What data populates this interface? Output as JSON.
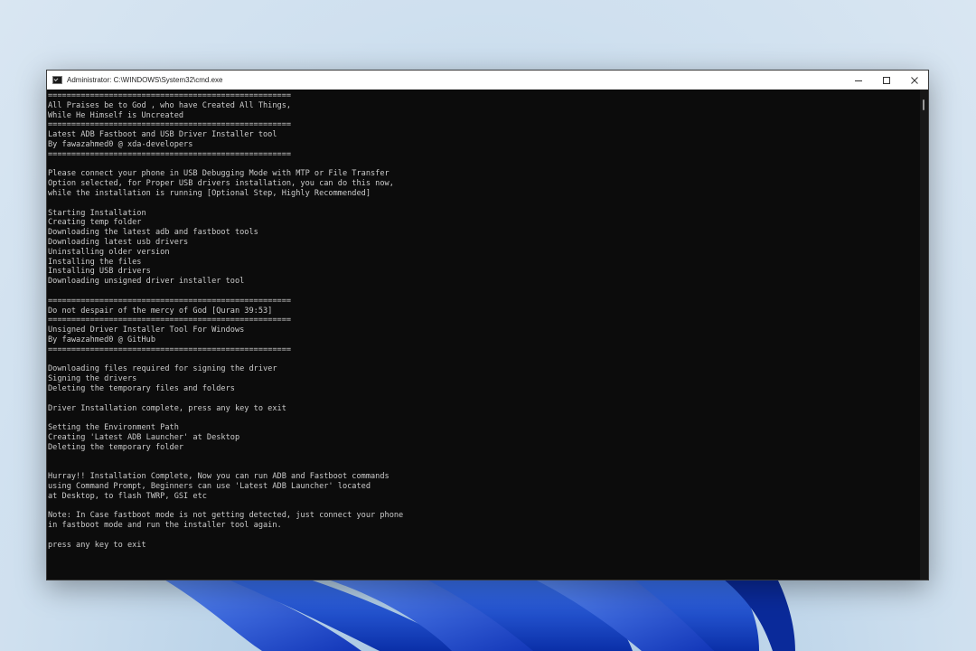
{
  "window": {
    "title": "Administrator: C:\\WINDOWS\\System32\\cmd.exe",
    "icon": "cmd-icon",
    "controls": {
      "minimize": "minimize-icon",
      "maximize": "maximize-icon",
      "close": "close-icon"
    }
  },
  "console": {
    "lines": [
      "====================================================",
      "All Praises be to God , who have Created All Things,",
      "While He Himself is Uncreated",
      "====================================================",
      "Latest ADB Fastboot and USB Driver Installer tool",
      "By fawazahmed0 @ xda-developers",
      "====================================================",
      "",
      "Please connect your phone in USB Debugging Mode with MTP or File Transfer",
      "Option selected, for Proper USB drivers installation, you can do this now,",
      "while the installation is running [Optional Step, Highly Recommended]",
      "",
      "Starting Installation",
      "Creating temp folder",
      "Downloading the latest adb and fastboot tools",
      "Downloading latest usb drivers",
      "Uninstalling older version",
      "Installing the files",
      "Installing USB drivers",
      "Downloading unsigned driver installer tool",
      "",
      "====================================================",
      "Do not despair of the mercy of God [Quran 39:53]",
      "====================================================",
      "Unsigned Driver Installer Tool For Windows",
      "By fawazahmed0 @ GitHub",
      "====================================================",
      "",
      "Downloading files required for signing the driver",
      "Signing the drivers",
      "Deleting the temporary files and folders",
      "",
      "Driver Installation complete, press any key to exit",
      "",
      "Setting the Environment Path",
      "Creating 'Latest ADB Launcher' at Desktop",
      "Deleting the temporary folder",
      "",
      "",
      "Hurray!! Installation Complete, Now you can run ADB and Fastboot commands",
      "using Command Prompt, Beginners can use 'Latest ADB Launcher' located",
      "at Desktop, to flash TWRP, GSI etc",
      "",
      "Note: In Case fastboot mode is not getting detected, just connect your phone",
      "in fastboot mode and run the installer tool again.",
      "",
      "press any key to exit"
    ]
  },
  "colors": {
    "console_bg": "#0c0c0c",
    "console_text": "#cccccc",
    "titlebar_bg": "#ffffff",
    "wallpaper_blue": "#1f4fd6"
  }
}
